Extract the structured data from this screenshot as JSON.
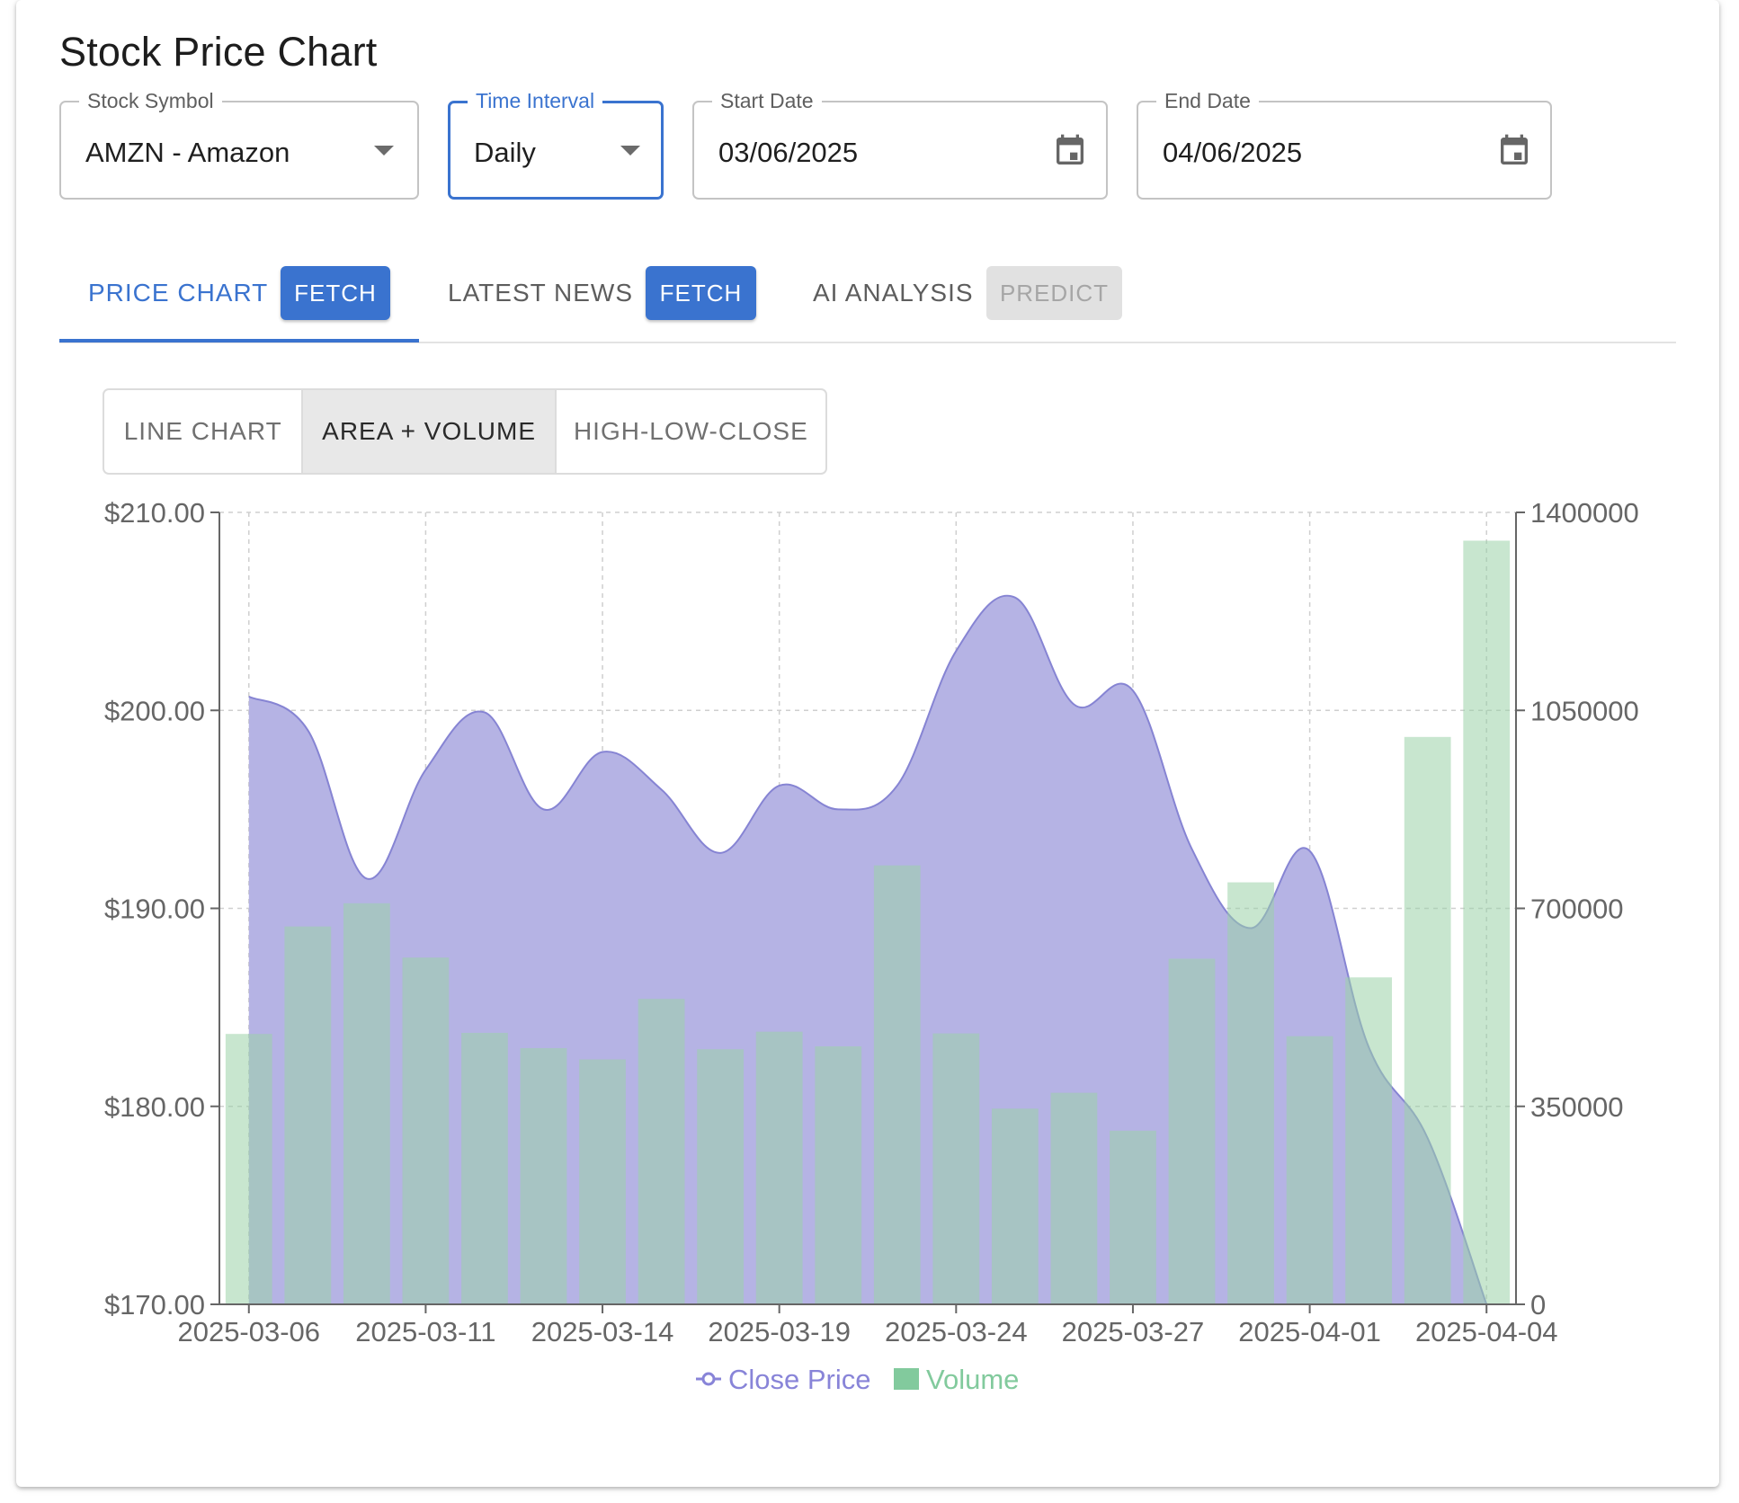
{
  "page": {
    "title": "Stock Price Chart"
  },
  "form": {
    "symbol": {
      "label": "Stock Symbol",
      "value": "AMZN - Amazon"
    },
    "interval": {
      "label": "Time Interval",
      "value": "Daily"
    },
    "start_date": {
      "label": "Start Date",
      "value": "03/06/2025"
    },
    "end_date": {
      "label": "End Date",
      "value": "04/06/2025"
    }
  },
  "tabs": [
    {
      "label": "PRICE CHART",
      "button": "FETCH",
      "active": true,
      "button_state": "primary"
    },
    {
      "label": "LATEST NEWS",
      "button": "FETCH",
      "active": false,
      "button_state": "primary"
    },
    {
      "label": "AI ANALYSIS",
      "button": "PREDICT",
      "active": false,
      "button_state": "disabled"
    }
  ],
  "chart_types": {
    "options": [
      "LINE CHART",
      "AREA + VOLUME",
      "HIGH-LOW-CLOSE"
    ],
    "selected": "AREA + VOLUME"
  },
  "colors": {
    "accent": "#3a73cf",
    "price_fill": "#b5b3e4",
    "price_stroke": "#8684d3",
    "volume_fill": "#9bd1a8",
    "legend_price": "#8884d8",
    "legend_volume": "#82ca9d"
  },
  "chart_data": {
    "type": "area",
    "x": [
      "2025-03-06",
      "2025-03-07",
      "2025-03-10",
      "2025-03-11",
      "2025-03-12",
      "2025-03-13",
      "2025-03-14",
      "2025-03-17",
      "2025-03-18",
      "2025-03-19",
      "2025-03-20",
      "2025-03-21",
      "2025-03-24",
      "2025-03-25",
      "2025-03-26",
      "2025-03-27",
      "2025-03-28",
      "2025-03-31",
      "2025-04-01",
      "2025-04-02",
      "2025-04-03",
      "2025-04-04"
    ],
    "x_tick_labels": [
      "2025-03-06",
      "2025-03-11",
      "2025-03-14",
      "2025-03-19",
      "2025-03-24",
      "2025-03-27",
      "2025-04-01",
      "2025-04-04"
    ],
    "series": [
      {
        "name": "Close Price",
        "type": "area",
        "axis": "left",
        "values": [
          200.7,
          199.0,
          191.5,
          197.0,
          199.9,
          195.0,
          197.9,
          196.0,
          192.8,
          196.2,
          195.0,
          196.2,
          203.0,
          205.7,
          200.3,
          201.0,
          193.0,
          189.0,
          192.9,
          183.0,
          178.4,
          170.0
        ]
      },
      {
        "name": "Volume",
        "type": "bar",
        "axis": "right",
        "values": [
          478000,
          668000,
          709000,
          613000,
          480000,
          453000,
          433000,
          540000,
          451000,
          482000,
          456000,
          776000,
          479000,
          346000,
          374000,
          307000,
          611000,
          746000,
          474000,
          578000,
          1003000,
          1350000
        ]
      }
    ],
    "y_left": {
      "range": [
        170,
        210
      ],
      "ticks": [
        "$170.00",
        "$180.00",
        "$190.00",
        "$200.00",
        "$210.00"
      ]
    },
    "y_right": {
      "range": [
        0,
        1400000
      ],
      "ticks": [
        "0",
        "350000",
        "700000",
        "1050000",
        "1400000"
      ]
    },
    "grid": true,
    "legend": {
      "position": "bottom",
      "items": [
        "Close Price",
        "Volume"
      ]
    }
  }
}
